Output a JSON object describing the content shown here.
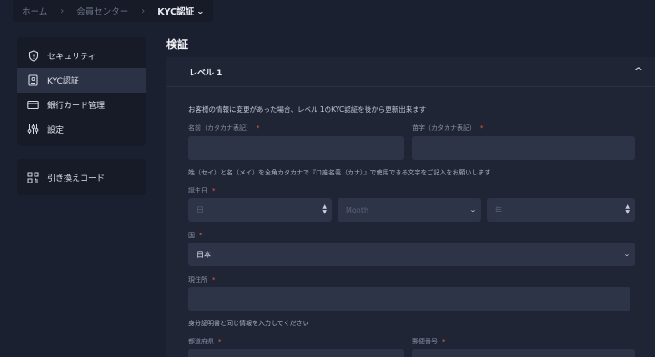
{
  "breadcrumb": {
    "home": "ホーム",
    "center": "会員センター",
    "current": "KYC認証"
  },
  "sidebar": {
    "items": [
      {
        "label": "セキュリティ",
        "icon": "shield-icon"
      },
      {
        "label": "KYC認証",
        "icon": "document-icon"
      },
      {
        "label": "銀行カード管理",
        "icon": "card-icon"
      },
      {
        "label": "設定",
        "icon": "sliders-icon"
      }
    ],
    "redeem": {
      "label": "引き換えコード",
      "icon": "qr-code-icon"
    }
  },
  "main": {
    "title": "検証",
    "level": "レベル 1",
    "intro": "お客様の情報に変更があった場合、レベル 1のKYC認証を後から更新出来ます",
    "given_name_label": "名前（カタカナ表記）",
    "family_name_label": "苗字（カタカナ表記）",
    "katakana_note": "姓（セイ）と名（メイ）を全角カタカナで『口座名義（カナ）』で使用できる文字をご記入をお願いします",
    "dob_label": "誕生日",
    "dob_day_placeholder": "日",
    "dob_month_placeholder": "Month",
    "dob_year_placeholder": "年",
    "country_label": "国",
    "country_value": "日本",
    "address_label": "現住所",
    "id_note": "身分証明書と同じ情報を入力してください",
    "prefecture_label": "都道府県",
    "postal_label": "郵便番号",
    "required_mark": "*"
  },
  "colors": {
    "background": "#1b2030",
    "panel": "#1f2535",
    "sidebar": "#171b27",
    "input": "#2d3448",
    "required": "#e8604c"
  }
}
